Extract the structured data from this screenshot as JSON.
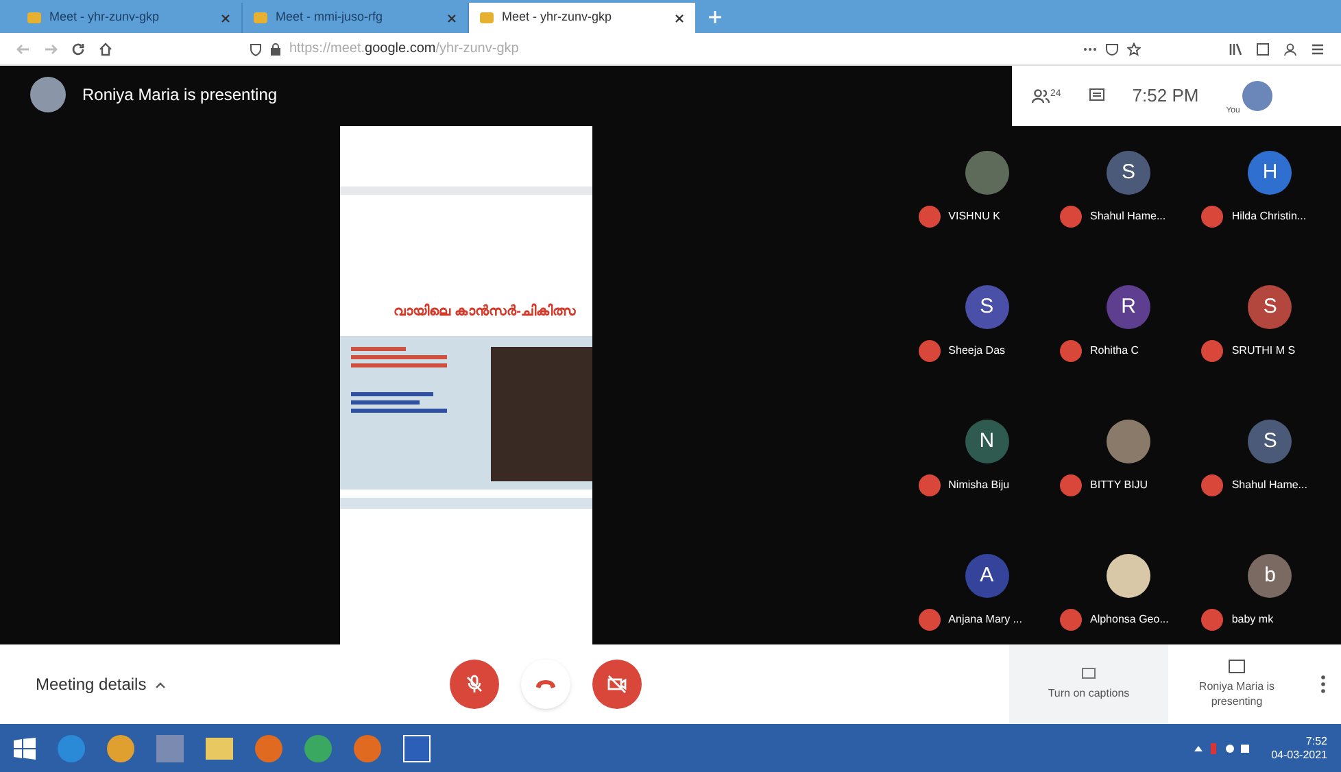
{
  "browser": {
    "tabs": [
      {
        "title": "Meet - yhr-zunv-gkp",
        "selected": false
      },
      {
        "title": "Meet - mmi-juso-rfg",
        "selected": false
      },
      {
        "title": "Meet - yhr-zunv-gkp",
        "selected": true
      }
    ],
    "url_host": "https://meet.",
    "url_domain": "google.com",
    "url_path": "/yhr-zunv-gkp"
  },
  "presenter_banner": "Roniya Maria is presenting",
  "info_panel": {
    "people_count": "24",
    "time": "7:52 PM",
    "self_label": "You"
  },
  "slide": {
    "title": "വായിലെ കാൻസർ-ചികിത്സ"
  },
  "participants": [
    {
      "name": "VISHNU K",
      "kind": "photo",
      "color": "#5f6b5a"
    },
    {
      "name": "Shahul Hame...",
      "kind": "letter",
      "initial": "S",
      "color": "#4a5a78"
    },
    {
      "name": "Hilda Christin...",
      "kind": "letter",
      "initial": "H",
      "color": "#2f6fd0"
    },
    {
      "name": "Sheeja Das",
      "kind": "letter",
      "initial": "S",
      "color": "#4a4fa8"
    },
    {
      "name": "Rohitha C",
      "kind": "letter",
      "initial": "R",
      "color": "#5e3f8f"
    },
    {
      "name": "SRUTHI M S",
      "kind": "letter",
      "initial": "S",
      "color": "#b3473d"
    },
    {
      "name": "Nimisha Biju",
      "kind": "letter",
      "initial": "N",
      "color": "#2f5a4f"
    },
    {
      "name": "BITTY BIJU",
      "kind": "photo",
      "color": "#8a7a6a"
    },
    {
      "name": "Shahul Hame...",
      "kind": "letter",
      "initial": "S",
      "color": "#4a5a78"
    },
    {
      "name": "Anjana Mary ...",
      "kind": "letter",
      "initial": "A",
      "color": "#35449a"
    },
    {
      "name": "Alphonsa Geo...",
      "kind": "photo",
      "color": "#d8c8a8"
    },
    {
      "name": "baby mk",
      "kind": "letter",
      "initial": "b",
      "color": "#7a6a62"
    }
  ],
  "bottom_bar": {
    "meeting_details": "Meeting details",
    "captions": "Turn on captions",
    "presenting": "Roniya Maria is presenting"
  },
  "taskbar": {
    "time": "7:52",
    "date": "04-03-2021"
  }
}
